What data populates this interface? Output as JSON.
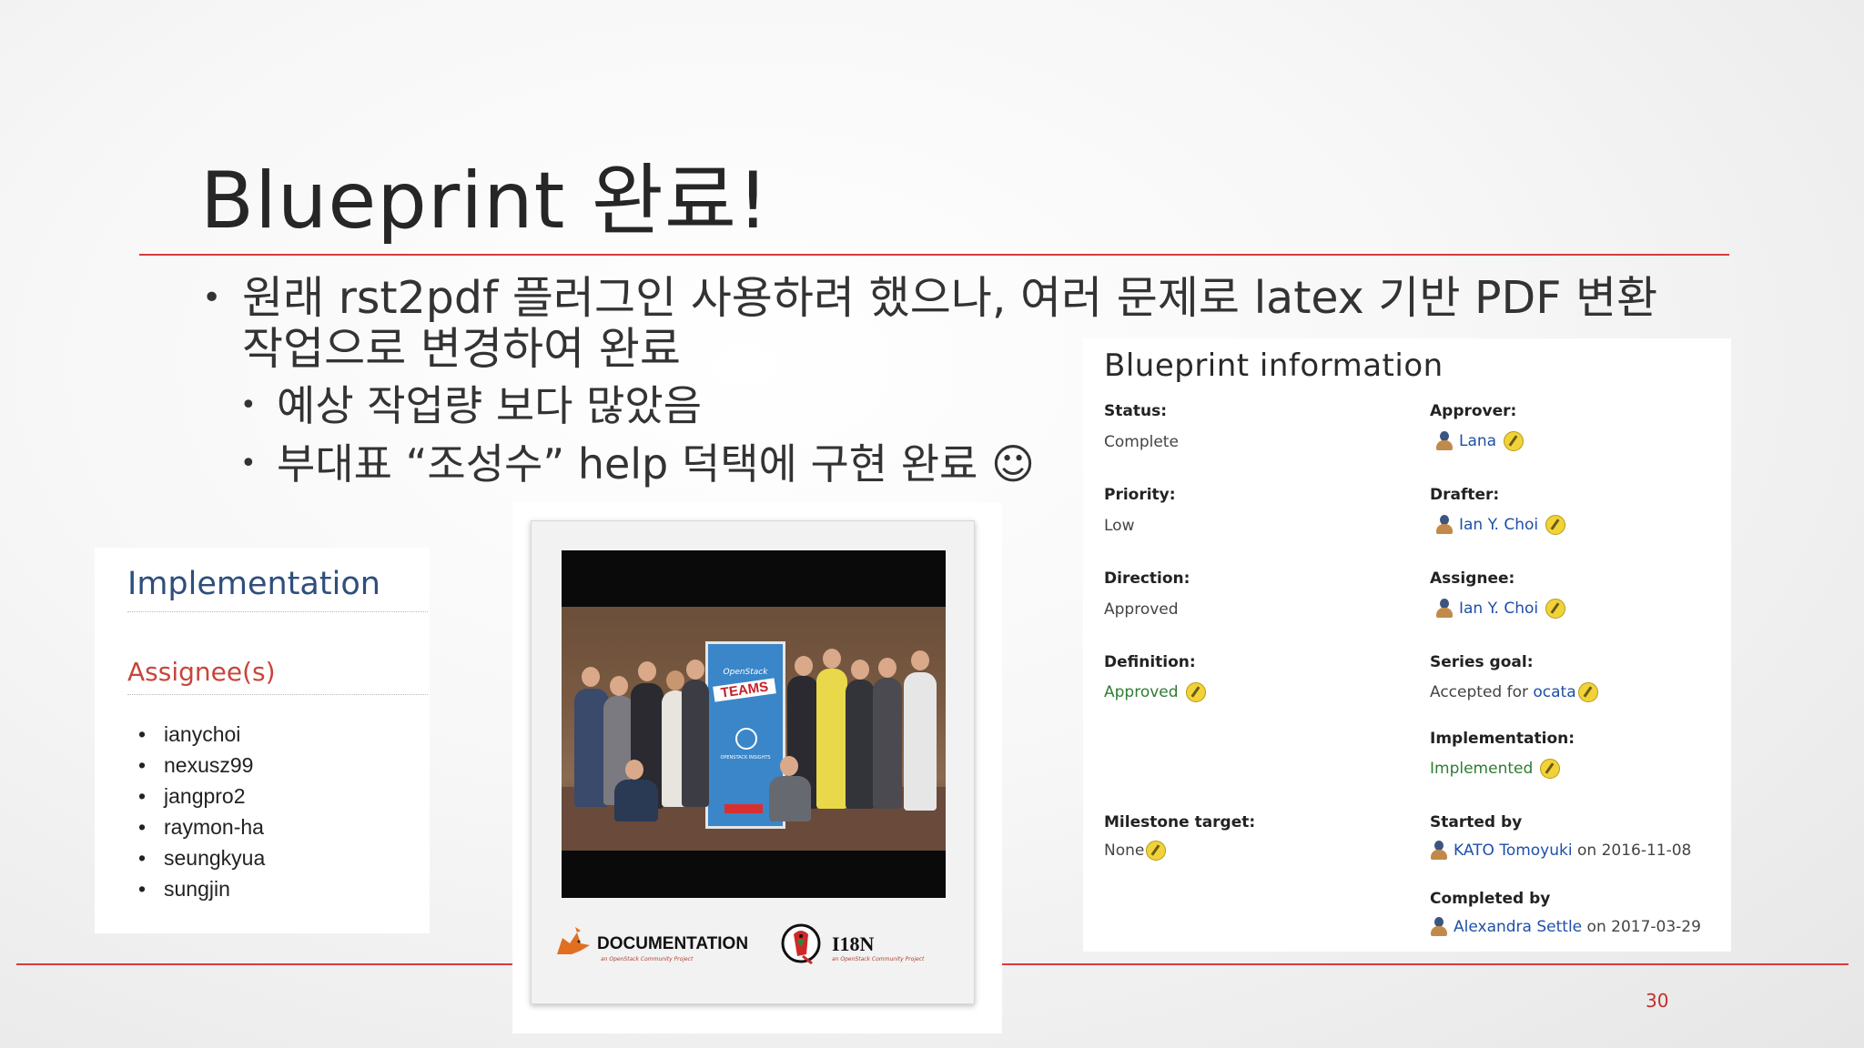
{
  "slide": {
    "title": "Blueprint 완료!",
    "bullets": {
      "main": "원래 rst2pdf 플러그인 사용하려 했으나, 여러 문제로 latex 기반 PDF 변환 작업으로 변경하여 완료",
      "sub1": "예상 작업량 보다 많았음",
      "sub2": "부대표 “조성수” help 덕택에 구현 완료 ☺"
    },
    "page_number": "30"
  },
  "implementation": {
    "heading": "Implementation",
    "subheading": "Assignee(s)",
    "assignees": [
      "ianychoi",
      "nexusz99",
      "jangpro2",
      "raymon-ha",
      "seungkyua",
      "sungjin"
    ]
  },
  "photo": {
    "banner_top": "OpenStack",
    "banner_text": "TEAMS",
    "banner_bottom": "OPENSTACK INSIGHTS",
    "logo_doc": "DOCUMENTATION",
    "logo_doc_sub": "an OpenStack Community Project",
    "logo_i18n": "I18N",
    "logo_i18n_sub": "an OpenStack Community Project"
  },
  "blueprint": {
    "heading": "Blueprint information",
    "status_label": "Status:",
    "status_value": "Complete",
    "approver_label": "Approver:",
    "approver_value": "Lana",
    "priority_label": "Priority:",
    "priority_value": "Low",
    "drafter_label": "Drafter:",
    "drafter_value": "Ian Y. Choi",
    "direction_label": "Direction:",
    "direction_value": "Approved",
    "assignee_label": "Assignee:",
    "assignee_value": "Ian Y. Choi",
    "definition_label": "Definition:",
    "definition_value": "Approved",
    "series_label": "Series goal:",
    "series_prefix": "Accepted for",
    "series_value": "ocata",
    "implementation_label": "Implementation:",
    "implementation_value": "Implemented",
    "milestone_label": "Milestone target:",
    "milestone_value": "None",
    "started_label": "Started by",
    "started_user": "KATO Tomoyuki",
    "started_date": "on 2016-11-08",
    "completed_label": "Completed by",
    "completed_user": "Alexandra Settle",
    "completed_date": "on 2017-03-29"
  }
}
